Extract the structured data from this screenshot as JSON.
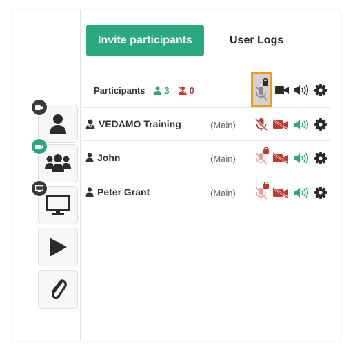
{
  "tabs": {
    "invite_label": "Invite participants",
    "user_logs_label": "User Logs"
  },
  "participants_header": {
    "title": "Participants",
    "online_count": "3",
    "offline_count": "0"
  },
  "participants": [
    {
      "name": "VEDAMO Training",
      "role": "(Main)",
      "is_host": true
    },
    {
      "name": "John",
      "role": "(Main)",
      "is_host": false
    },
    {
      "name": "Peter Grant",
      "role": "(Main)",
      "is_host": false
    }
  ],
  "toolbar": {
    "tools": [
      {
        "name": "single-participant-view",
        "icon": "person-icon",
        "badge": "camera-icon",
        "badge_color": "#3a3a3a"
      },
      {
        "name": "group-view",
        "icon": "people-icon",
        "badge": "camera-icon",
        "badge_color": "#29a882"
      },
      {
        "name": "screen-share",
        "icon": "monitor-icon",
        "badge": "screen-icon",
        "badge_color": "#3a3a3a"
      },
      {
        "name": "play-media",
        "icon": "play-icon"
      },
      {
        "name": "attach-file",
        "icon": "paperclip-icon"
      }
    ]
  },
  "colors": {
    "accent": "#29a882",
    "muted": "#c0392b",
    "highlight": "#f39c12",
    "icon_dark": "#2b2b2b"
  }
}
